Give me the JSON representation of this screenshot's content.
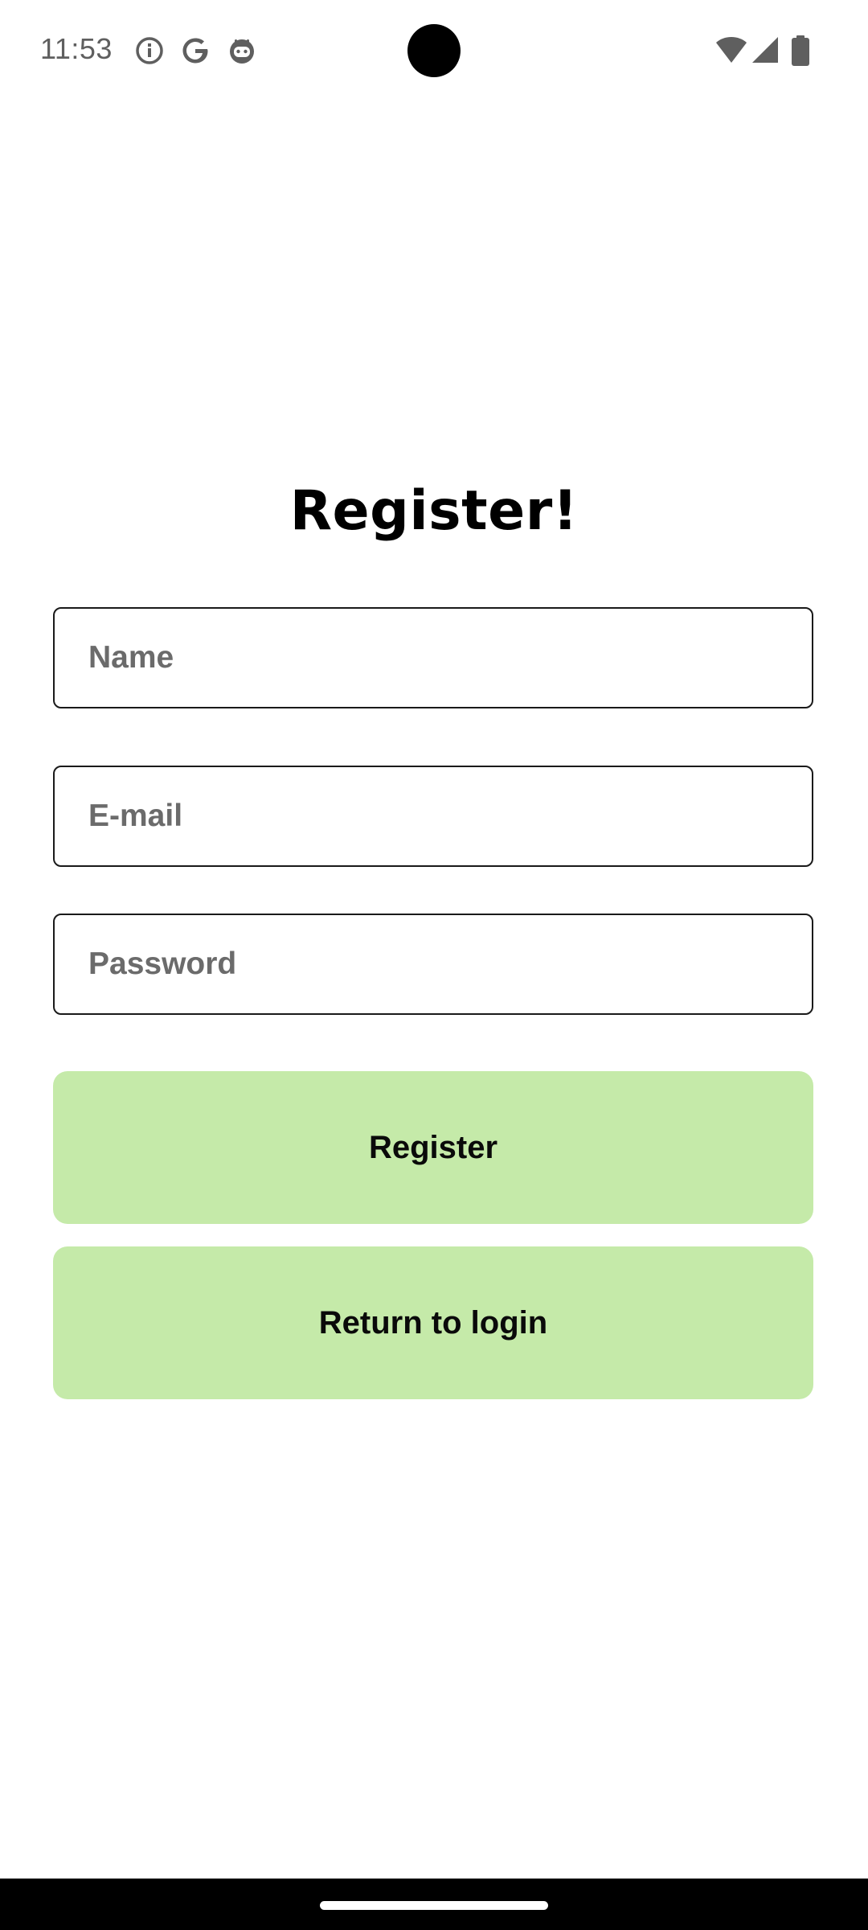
{
  "status_bar": {
    "time": "11:53",
    "left_icons": [
      "info-icon",
      "google-g-icon",
      "android-face-icon"
    ],
    "right_icons": [
      "wifi-icon",
      "cell-signal-icon",
      "battery-icon"
    ]
  },
  "page": {
    "title": "Register!"
  },
  "form": {
    "name_placeholder": "Name",
    "email_placeholder": "E-mail",
    "password_placeholder": "Password"
  },
  "actions": {
    "register_label": "Register",
    "return_label": "Return to login"
  },
  "colors": {
    "button_bg": "#c5eaa9",
    "field_border": "#1a1a1a"
  }
}
